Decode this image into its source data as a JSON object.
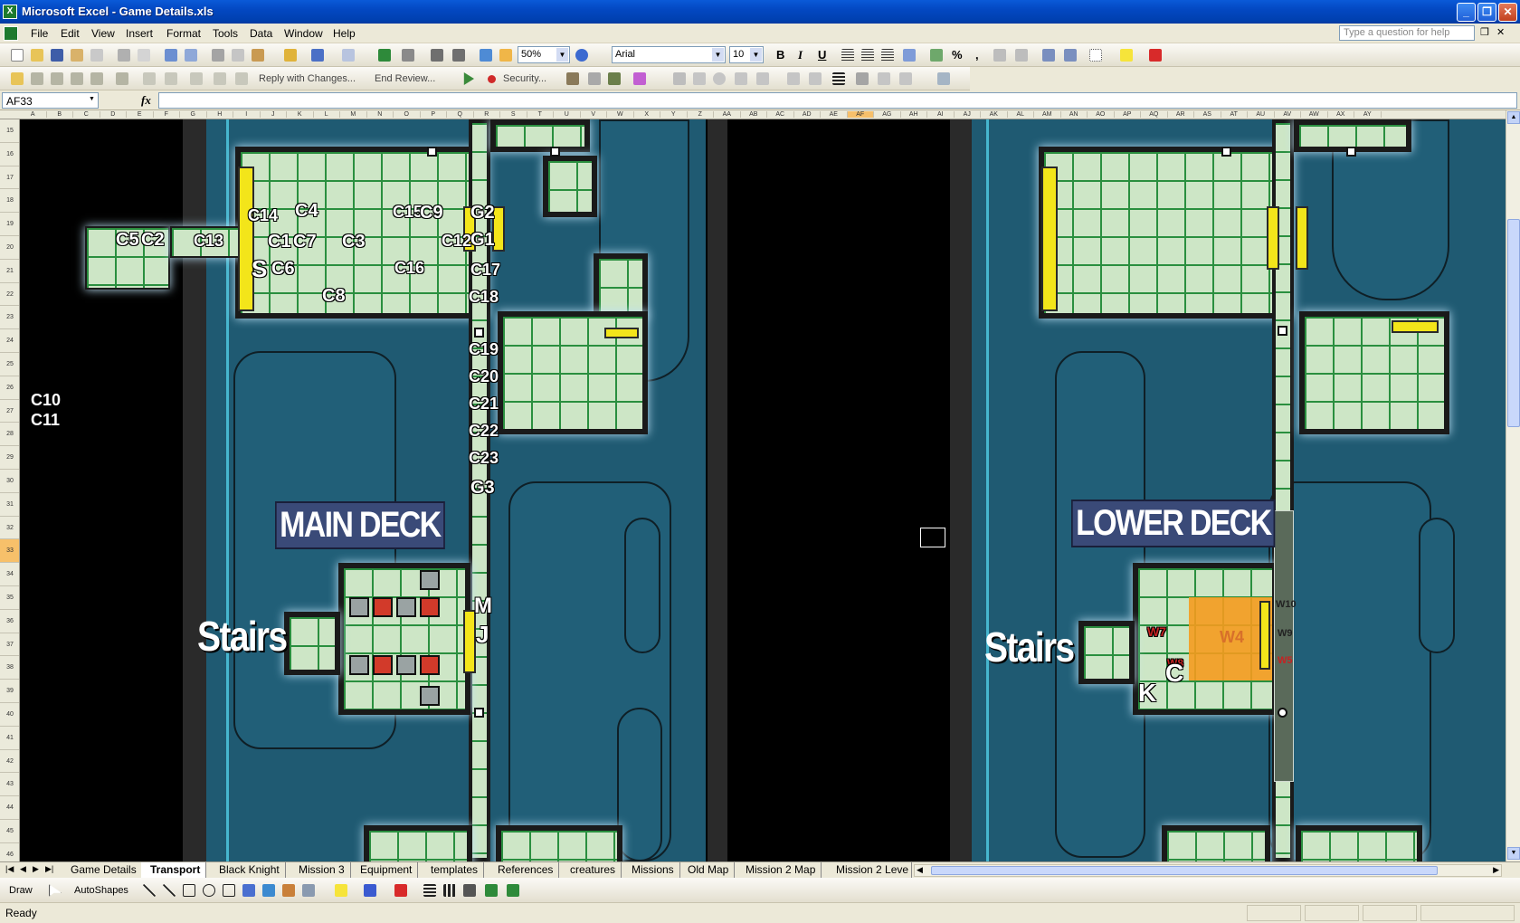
{
  "window": {
    "title": "Microsoft Excel - Game Details.xls",
    "minimize": "_",
    "restore": "❐",
    "close": "✕"
  },
  "menu": {
    "items": [
      "File",
      "Edit",
      "View",
      "Insert",
      "Format",
      "Tools",
      "Data",
      "Window",
      "Help"
    ],
    "help_placeholder": "Type a question for help",
    "mdi_restore": "❐",
    "mdi_close": "✕"
  },
  "toolbar": {
    "zoom": "50%",
    "font_name": "Arial",
    "font_size": "10",
    "bold": "B",
    "italic": "I",
    "underline": "U",
    "percent": "%",
    "comma": ",",
    "reply_changes": "Reply with Changes...",
    "end_review": "End Review...",
    "security": "Security..."
  },
  "formula_bar": {
    "name_box": "AF33",
    "fx": "fx",
    "formula": ""
  },
  "columns": [
    "A",
    "B",
    "C",
    "D",
    "E",
    "F",
    "G",
    "H",
    "I",
    "J",
    "K",
    "L",
    "M",
    "N",
    "O",
    "P",
    "Q",
    "R",
    "S",
    "T",
    "U",
    "V",
    "W",
    "X",
    "Y",
    "Z",
    "AA",
    "AB",
    "AC",
    "AD",
    "AE",
    "AF",
    "AG",
    "AH",
    "AI",
    "AJ",
    "AK",
    "AL",
    "AM",
    "AN",
    "AO",
    "AP",
    "AQ",
    "AR",
    "AS",
    "AT",
    "AU",
    "AV",
    "AW",
    "AX",
    "AY"
  ],
  "selected_column": "AF",
  "rows": [
    "15",
    "16",
    "17",
    "18",
    "19",
    "20",
    "21",
    "22",
    "23",
    "24",
    "25",
    "26",
    "27",
    "28",
    "29",
    "30",
    "31",
    "32",
    "33",
    "34",
    "35",
    "36",
    "37",
    "38",
    "39",
    "40",
    "41",
    "42",
    "43",
    "44",
    "45",
    "46"
  ],
  "selected_row": "33",
  "map": {
    "main_deck_title": "MAIN DECK",
    "lower_deck_title": "LOWER DECK",
    "stairs_label": "Stairs",
    "labels_main": {
      "c5": "C5",
      "c2": "C2",
      "c13": "C13",
      "c14": "C14",
      "c4": "C4",
      "c1": "C1",
      "c7": "C7",
      "c3": "C3",
      "c15": "C15",
      "c9": "C9",
      "c12": "C12",
      "s": "S",
      "c6": "C6",
      "c16": "C16",
      "c8": "C8",
      "g2": "G2",
      "g1": "G1",
      "c17": "C17",
      "c18": "C18",
      "c19": "C19",
      "c20": "C20",
      "c21": "C21",
      "c22": "C22",
      "c23": "C23",
      "g3": "G3",
      "m": "M",
      "j": "J",
      "c10": "C10",
      "c11": "C11"
    },
    "labels_lower": {
      "w7": "W7",
      "w4": "W4",
      "w8": "W8",
      "c": "C",
      "k": "K",
      "w10": "W10",
      "w9": "W9",
      "w5": "W5"
    }
  },
  "sheet_tabs": [
    "Game Details",
    "Transport",
    "Black Knight",
    "Mission 3",
    "Equipment",
    "templates",
    "References",
    "creatures",
    "Missions",
    "Old Map",
    "Mission 2 Map",
    "Mission 2 Leve"
  ],
  "active_tab": "Transport",
  "draw_toolbar": {
    "draw": "Draw",
    "autoshapes": "AutoShapes"
  },
  "status": "Ready",
  "colors": {
    "room_fill": "#cde6c6",
    "grid_line": "#2a8f3f",
    "hull": "#1f5a72",
    "door": "#f3e51a",
    "highlight_zone": "#f59b1e",
    "deck_title_bg": "#3a4a78"
  }
}
